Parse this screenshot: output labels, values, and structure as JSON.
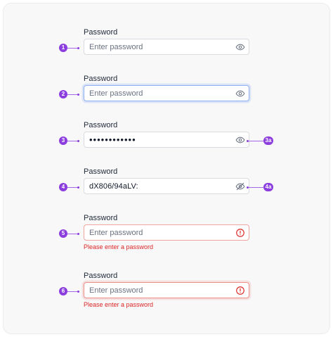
{
  "fields": [
    {
      "label": "Password",
      "placeholder": "Enter password",
      "marker": "1"
    },
    {
      "label": "Password",
      "placeholder": "Enter password",
      "marker": "2"
    },
    {
      "label": "Password",
      "value": "••••••••••••",
      "marker": "3",
      "icon_marker": "3a"
    },
    {
      "label": "Password",
      "value": "dX806/94aLV:",
      "marker": "4",
      "icon_marker": "4a"
    },
    {
      "label": "Password",
      "placeholder": "Enter password",
      "marker": "5",
      "error": "Please enter a password"
    },
    {
      "label": "Password",
      "placeholder": "Enter password",
      "marker": "6",
      "error": "Please enter a password"
    }
  ],
  "colors": {
    "marker": "#8b3dde",
    "focus_border": "#8fb1f2",
    "error_border": "#f1a5a0",
    "error_text": "#dc2626"
  },
  "icons": {
    "show": "eye-icon",
    "hide": "eye-off-icon",
    "error": "alert-circle-icon"
  }
}
